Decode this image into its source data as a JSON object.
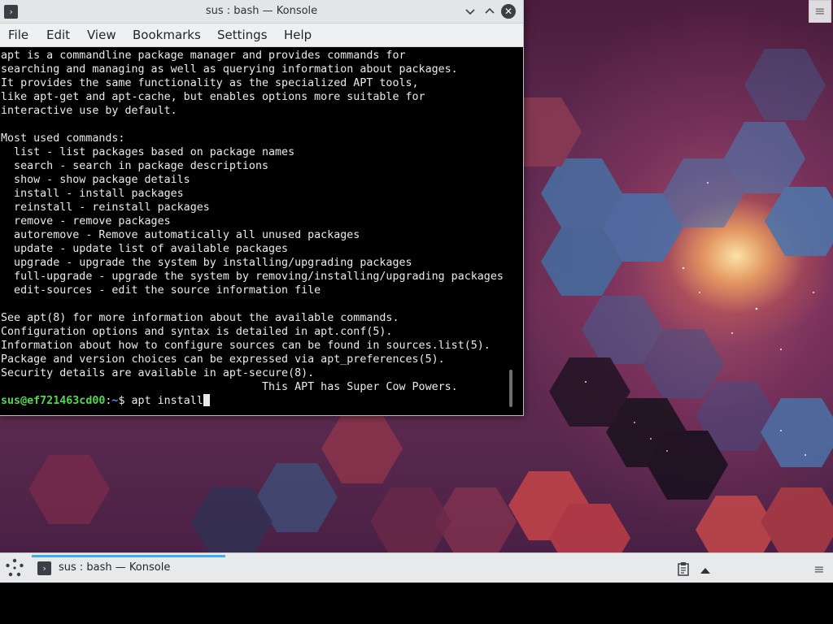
{
  "window": {
    "title": "sus : bash — Konsole",
    "app_icon_glyph": "›",
    "controls": {
      "minimize": "⌄",
      "maximize": "⌃",
      "close": "✕"
    }
  },
  "menubar": {
    "items": [
      "File",
      "Edit",
      "View",
      "Bookmarks",
      "Settings",
      "Help"
    ]
  },
  "terminal": {
    "lines": [
      "apt is a commandline package manager and provides commands for",
      "searching and managing as well as querying information about packages.",
      "It provides the same functionality as the specialized APT tools,",
      "like apt-get and apt-cache, but enables options more suitable for",
      "interactive use by default.",
      "",
      "Most used commands:",
      "  list - list packages based on package names",
      "  search - search in package descriptions",
      "  show - show package details",
      "  install - install packages",
      "  reinstall - reinstall packages",
      "  remove - remove packages",
      "  autoremove - Remove automatically all unused packages",
      "  update - update list of available packages",
      "  upgrade - upgrade the system by installing/upgrading packages",
      "  full-upgrade - upgrade the system by removing/installing/upgrading packages",
      "  edit-sources - edit the source information file",
      "",
      "See apt(8) for more information about the available commands.",
      "Configuration options and syntax is detailed in apt.conf(5).",
      "Information about how to configure sources can be found in sources.list(5).",
      "Package and version choices can be expressed via apt_preferences(5).",
      "Security details are available in apt-secure(8).",
      "                                        This APT has Super Cow Powers."
    ],
    "prompt": {
      "user_host": "sus@ef721463cd00",
      "separator": ":",
      "path": "~",
      "symbol": "$ ",
      "command": "apt install"
    },
    "colors": {
      "background": "#000000",
      "text": "#eaeaea",
      "user": "#55d655",
      "path": "#6b8cf0"
    }
  },
  "taskbar": {
    "task_label": "sus : bash — Konsole",
    "task_icon_glyph": "›",
    "panel_menu_glyph": "≡",
    "accent": "#3daee9"
  },
  "desktop": {
    "menu_glyph": "≡"
  },
  "icons": {
    "launcher": "application-launcher-icon",
    "clipboard": "clipboard-icon",
    "tray_expand": "tray-expand-icon",
    "panel_menu": "hamburger-menu-icon"
  }
}
